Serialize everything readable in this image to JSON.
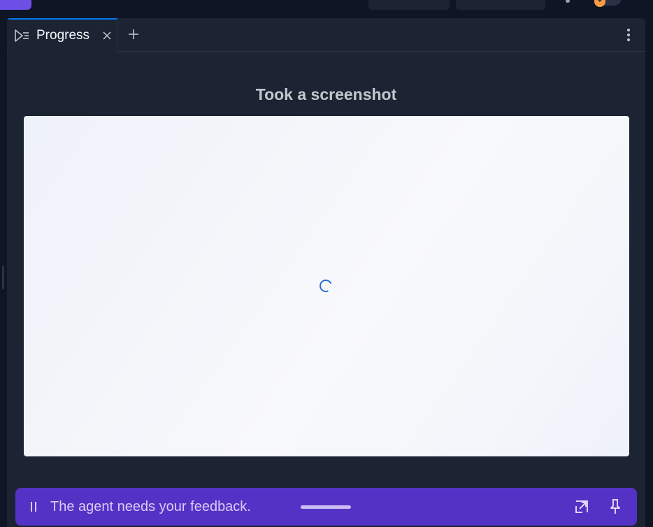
{
  "tab": {
    "label": "Progress",
    "icon": "progress-icon",
    "close_icon": "close-icon"
  },
  "add_tab_icon": "plus-icon",
  "more_icon": "kebab-menu-icon",
  "content": {
    "title": "Took a screenshot",
    "loading_icon": "spinner-icon"
  },
  "feedback": {
    "message": "The agent needs your feedback.",
    "pause_icon": "pause-icon",
    "expand_icon": "expand-arrow-icon",
    "pin_icon": "pin-icon"
  },
  "colors": {
    "background": "#0e1525",
    "panel": "#1c2333",
    "tab_accent": "#0079f2",
    "feedback_bar": "#5532c6",
    "brand": "#6e4fe6"
  }
}
